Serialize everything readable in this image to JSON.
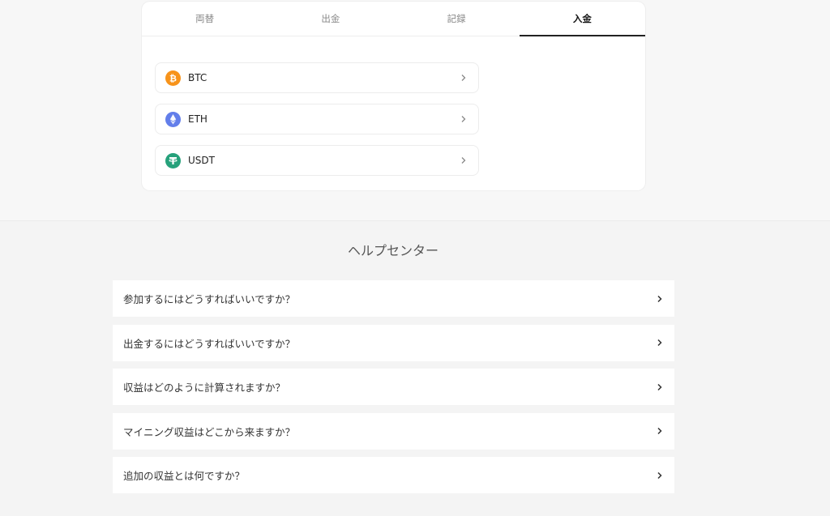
{
  "tabs": [
    {
      "label": "両替",
      "active": false
    },
    {
      "label": "出金",
      "active": false
    },
    {
      "label": "記録",
      "active": false
    },
    {
      "label": "入金",
      "active": true
    }
  ],
  "coins": [
    {
      "symbol": "BTC",
      "icon": "bitcoin-icon",
      "color": "#f7931a"
    },
    {
      "symbol": "ETH",
      "icon": "ethereum-icon",
      "color": "#627eea"
    },
    {
      "symbol": "USDT",
      "icon": "tether-icon",
      "color": "#26a17b"
    }
  ],
  "help": {
    "title": "ヘルプセンター",
    "faqs": [
      "参加するにはどうすればいいですか？",
      "出金するにはどうすればいいですか？",
      "収益はどのように計算されますか？",
      "マイニング収益はどこから来ますか？",
      "追加の収益とは何ですか？"
    ]
  }
}
